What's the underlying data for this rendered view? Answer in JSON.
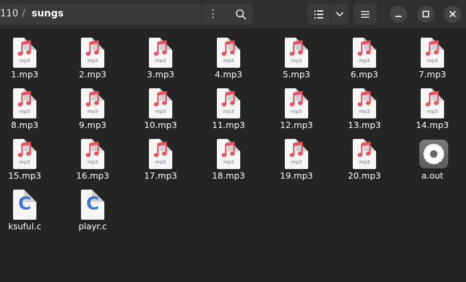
{
  "breadcrumb": {
    "parent": "110",
    "separator": "/",
    "current": "sungs"
  },
  "header": {
    "path_menu_glyph": "⋮",
    "icons": [
      "search-icon",
      "list-view-icon",
      "chevron-down-icon",
      "hamburger-menu-icon",
      "minimize-icon",
      "maximize-icon",
      "close-icon"
    ]
  },
  "colors": {
    "music_note": "#e8515f",
    "c_letter": "#3b74d8",
    "background": "#242424",
    "header": "#303030"
  },
  "files": [
    {
      "name": "1.mp3",
      "type": "audio",
      "icon_text": "mp3"
    },
    {
      "name": "2.mp3",
      "type": "audio",
      "icon_text": "mp3"
    },
    {
      "name": "3.mp3",
      "type": "audio",
      "icon_text": "mp3"
    },
    {
      "name": "4.mp3",
      "type": "audio",
      "icon_text": "mp3"
    },
    {
      "name": "5.mp3",
      "type": "audio",
      "icon_text": "mp3"
    },
    {
      "name": "6.mp3",
      "type": "audio",
      "icon_text": "mp3"
    },
    {
      "name": "7.mp3",
      "type": "audio",
      "icon_text": "mp3"
    },
    {
      "name": "8.mp3",
      "type": "audio",
      "icon_text": "mp3"
    },
    {
      "name": "9.mp3",
      "type": "audio",
      "icon_text": "mp3"
    },
    {
      "name": "10.mp3",
      "type": "audio",
      "icon_text": "mp3"
    },
    {
      "name": "11.mp3",
      "type": "audio",
      "icon_text": "mp3"
    },
    {
      "name": "12.mp3",
      "type": "audio",
      "icon_text": "mp3"
    },
    {
      "name": "13.mp3",
      "type": "audio",
      "icon_text": "mp3"
    },
    {
      "name": "14.mp3",
      "type": "audio",
      "icon_text": "mp3"
    },
    {
      "name": "15.mp3",
      "type": "audio",
      "icon_text": "mp3"
    },
    {
      "name": "16.mp3",
      "type": "audio",
      "icon_text": "mp3"
    },
    {
      "name": "17.mp3",
      "type": "audio",
      "icon_text": "mp3"
    },
    {
      "name": "18.mp3",
      "type": "audio",
      "icon_text": "mp3"
    },
    {
      "name": "19.mp3",
      "type": "audio",
      "icon_text": "mp3"
    },
    {
      "name": "20.mp3",
      "type": "audio",
      "icon_text": "mp3"
    },
    {
      "name": "a.out",
      "type": "executable",
      "icon_text": ""
    },
    {
      "name": "ksuful.c",
      "type": "c-source",
      "icon_text": "C"
    },
    {
      "name": "playr.c",
      "type": "c-source",
      "icon_text": "C"
    }
  ]
}
